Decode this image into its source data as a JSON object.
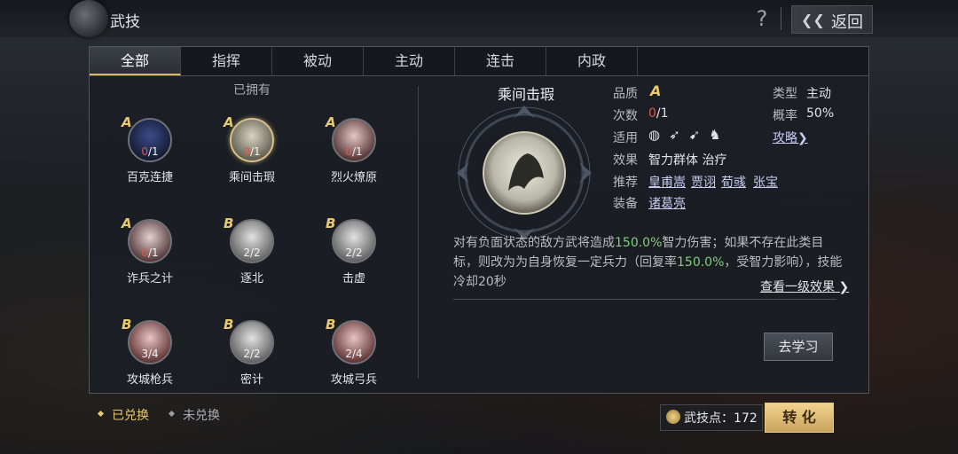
{
  "header": {
    "title": "武技",
    "help_label": "?",
    "back_label": "返回"
  },
  "tabs": [
    {
      "label": "全部",
      "active": true
    },
    {
      "label": "指挥",
      "active": false
    },
    {
      "label": "被动",
      "active": false
    },
    {
      "label": "主动",
      "active": false
    },
    {
      "label": "连击",
      "active": false
    },
    {
      "label": "内政",
      "active": false
    }
  ],
  "skills_section": {
    "owned_label": "已拥有"
  },
  "skills": [
    {
      "name": "百克连捷",
      "grade": "A",
      "owned": "0",
      "total": "/1"
    },
    {
      "name": "乘间击瑕",
      "grade": "A",
      "owned": "0",
      "total": "/1",
      "selected": true
    },
    {
      "name": "烈火燎原",
      "grade": "A",
      "owned": "0",
      "total": "/1"
    },
    {
      "name": "诈兵之计",
      "grade": "A",
      "owned": "0",
      "total": "/1"
    },
    {
      "name": "逐北",
      "grade": "B",
      "owned": "2",
      "total": "/2"
    },
    {
      "name": "击虚",
      "grade": "B",
      "owned": "2",
      "total": "/2"
    },
    {
      "name": "攻城枪兵",
      "grade": "B",
      "owned": "3",
      "total": "/4"
    },
    {
      "name": "密计",
      "grade": "B",
      "owned": "2",
      "total": "/2"
    },
    {
      "name": "攻城弓兵",
      "grade": "B",
      "owned": "2",
      "total": "/4"
    }
  ],
  "detail": {
    "name": "乘间击瑕",
    "quality_label": "品质",
    "quality_value": "A",
    "times_label": "次数",
    "times_owned": "0",
    "times_total": "/1",
    "apply_label": "适用",
    "effect_label": "效果",
    "effect_value": "智力群体 治疗",
    "recommend_label": "推荐",
    "recommend": [
      "皇甫嵩",
      "贾诩",
      "荀彧",
      "张宝"
    ],
    "equip_label": "装备",
    "equip_value": "诸葛亮",
    "type_label": "类型",
    "type_value": "主动",
    "rate_label": "概率",
    "rate_value": "50%",
    "guide_label": "攻略",
    "desc_1": "对有负面状态的敌方武将造成",
    "desc_hl1": "150.0%",
    "desc_2": "智力伤害；如果不存在此类目标，则改为为自身恢复一定兵力（回复率",
    "desc_hl2": "150.0%",
    "desc_3": "，受智力影响），技能冷却20秒",
    "view_more": "查看一级效果",
    "learn_button": "去学习"
  },
  "footer": {
    "redeemed": "已兑换",
    "not_redeemed": "未兑换",
    "points_label": "武技点：",
    "points_value": "172",
    "convert_button": "转 化"
  },
  "colors": {
    "gold": "#e8c96e",
    "red": "#e0574b",
    "green": "#7ecf7e",
    "link": "#c7ccf0"
  }
}
